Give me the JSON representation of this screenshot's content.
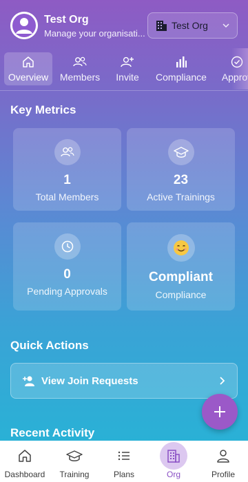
{
  "header": {
    "org_name": "Test Org",
    "org_subtitle": "Manage your organisati...",
    "org_selector_label": "Test Org"
  },
  "tabs": [
    {
      "label": "Overview",
      "icon": "home-icon",
      "active": true
    },
    {
      "label": "Members",
      "icon": "users-icon"
    },
    {
      "label": "Invite",
      "icon": "user-plus-icon"
    },
    {
      "label": "Compliance",
      "icon": "bar-chart-icon"
    },
    {
      "label": "Approv",
      "icon": "check-circle-icon"
    }
  ],
  "metrics": {
    "title": "Key Metrics",
    "cards": [
      {
        "value": "1",
        "label": "Total Members",
        "icon": "users-icon"
      },
      {
        "value": "23",
        "label": "Active Trainings",
        "icon": "graduation-cap-icon"
      },
      {
        "value": "0",
        "label": "Pending Approvals",
        "icon": "clock-icon"
      },
      {
        "value": "Compliant",
        "label": "Compliance",
        "icon": "smiley-icon"
      }
    ]
  },
  "quick_actions": {
    "title": "Quick Actions",
    "items": [
      {
        "label": "View Join Requests",
        "icon": "user-plus-icon"
      }
    ]
  },
  "recent_activity": {
    "title": "Recent Activity"
  },
  "bottom_nav": [
    {
      "label": "Dashboard",
      "icon": "home-icon"
    },
    {
      "label": "Training",
      "icon": "graduation-cap-icon"
    },
    {
      "label": "Plans",
      "icon": "list-icon"
    },
    {
      "label": "Org",
      "icon": "building-icon",
      "active": true
    },
    {
      "label": "Profile",
      "icon": "person-icon"
    }
  ],
  "colors": {
    "accent": "#9b59c8",
    "active_nav_bg": "#dcc8f0",
    "active_nav_text": "#8a4fc4"
  }
}
